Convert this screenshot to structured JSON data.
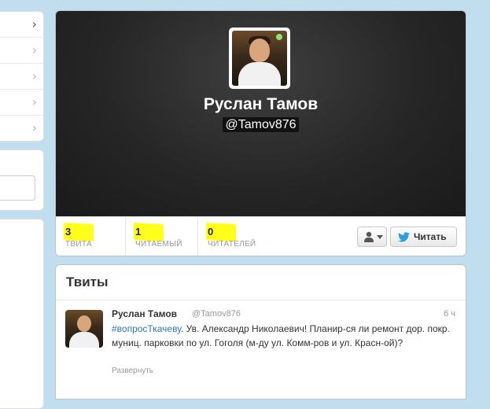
{
  "profile": {
    "name": "Руслан Тамов",
    "handle": "@Tamov876"
  },
  "stats": {
    "tweets": {
      "value": "3",
      "label": "ТВИТА"
    },
    "following": {
      "value": "1",
      "label": "ЧИТАЕМЫЙ"
    },
    "followers": {
      "value": "0",
      "label": "ЧИТАТЕЛЕЙ"
    }
  },
  "actions": {
    "follow_label": "Читать",
    "user_menu_icon": "person-icon"
  },
  "tweets_section": {
    "title": "Твиты",
    "items": [
      {
        "author": "Руслан Тамов",
        "handle": "@Tamov876",
        "time": "6 ч",
        "hashtag": "#вопросТкачеву",
        "text": ". Ув. Александр Николаевич! Планир-ся ли ремонт дор. покр. муниц. парковки по ул. Гоголя (м-ду ул. Комм-ров и ул. Красн-ой)?",
        "expand": "Развернуть"
      }
    ]
  },
  "colors": {
    "background": "#c0deed",
    "highlight": "#ffff1a",
    "link": "#2a7ab0",
    "twitter_blue": "#2b9fe0"
  }
}
